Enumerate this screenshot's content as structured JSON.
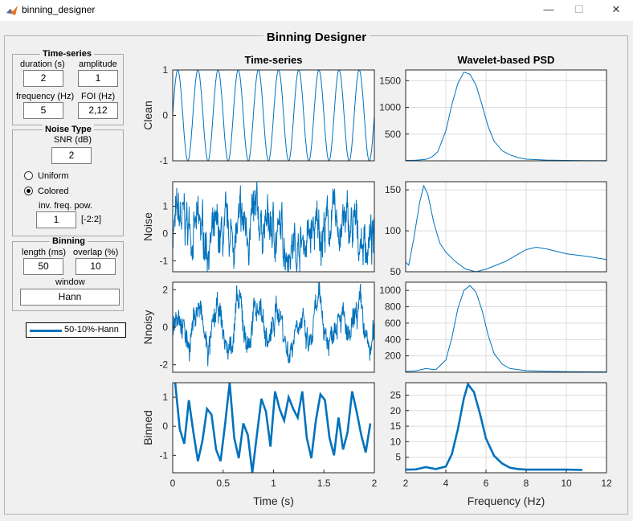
{
  "window": {
    "title": "binning_designer",
    "minimize_glyph": "—",
    "maximize_glyph": "☐",
    "close_glyph": "✕"
  },
  "panel_title": "Binning Designer",
  "timeseries_group": {
    "title": "Time-series",
    "duration_label": "duration (s)",
    "duration_value": "2",
    "amplitude_label": "amplitude",
    "amplitude_value": "1",
    "frequency_label": "frequency (Hz)",
    "frequency_value": "5",
    "foi_label": "FOI (Hz)",
    "foi_value": "2,12"
  },
  "noise_group": {
    "title": "Noise Type",
    "snr_label": "SNR (dB)",
    "snr_value": "2",
    "uniform_label": "Uniform",
    "colored_label": "Colored",
    "selected": "Colored",
    "inv_freq_label": "inv. freq. pow.",
    "inv_freq_value": "1",
    "inv_freq_range": "[-2:2]"
  },
  "binning_group": {
    "title": "Binning",
    "length_label": "length (ms)",
    "length_value": "50",
    "overlap_label": "overlap (%)",
    "overlap_value": "10",
    "window_label": "window",
    "window_value": "Hann"
  },
  "legend": {
    "label": "50-10%-Hann",
    "color": "#0072bd"
  },
  "colors": {
    "line": "#0072bd",
    "grid": "#dcdcdc"
  },
  "chart_data": [
    {
      "type": "line",
      "title": "Time-series",
      "ylabel": "Clean",
      "xlim": [
        0,
        2
      ],
      "ylim": [
        -1,
        1
      ],
      "yticks": [
        -1,
        0,
        1
      ],
      "series": [
        {
          "function": "sin",
          "frequency": 5,
          "amplitude": 1
        }
      ]
    },
    {
      "type": "line",
      "title": "Wavelet-based PSD",
      "xlim": [
        2,
        12
      ],
      "ylim": [
        0,
        1700
      ],
      "yticks": [
        500,
        1000,
        1500
      ],
      "series": [
        {
          "x": [
            2,
            2.5,
            3,
            3.3,
            3.6,
            4,
            4.3,
            4.6,
            4.9,
            5.2,
            5.5,
            5.8,
            6.1,
            6.4,
            6.8,
            7.2,
            7.6,
            8,
            9,
            10,
            10.5,
            11,
            12
          ],
          "y": [
            8,
            10,
            25,
            70,
            170,
            560,
            1050,
            1450,
            1660,
            1620,
            1420,
            1050,
            650,
            370,
            190,
            110,
            60,
            30,
            14,
            8,
            6,
            5,
            5
          ]
        }
      ]
    },
    {
      "type": "line",
      "ylabel": "Noise",
      "xlim": [
        0,
        2
      ],
      "ylim": [
        -1.4,
        1.9
      ],
      "yticks": [
        -1,
        0,
        1
      ],
      "series": [
        {
          "kind": "noise",
          "range": [
            -1.4,
            1.9
          ]
        }
      ]
    },
    {
      "type": "line",
      "xlim": [
        2,
        12
      ],
      "ylim": [
        50,
        160
      ],
      "yticks": [
        50,
        100,
        150
      ],
      "series": [
        {
          "x": [
            2,
            2.15,
            2.4,
            2.7,
            2.9,
            3.1,
            3.4,
            3.7,
            4,
            4.5,
            5,
            5.5,
            6,
            6.5,
            7,
            7.5,
            8,
            8.5,
            9,
            10,
            11,
            12
          ],
          "y": [
            62,
            58,
            90,
            135,
            155,
            145,
            110,
            85,
            74,
            62,
            53,
            50,
            53,
            58,
            63,
            70,
            77,
            80,
            78,
            72,
            69,
            65
          ]
        }
      ]
    },
    {
      "type": "line",
      "ylabel": "Nnoisy",
      "xlim": [
        0,
        2
      ],
      "ylim": [
        -2.4,
        2.4
      ],
      "yticks": [
        -2,
        0,
        2
      ],
      "series": [
        {
          "kind": "noisy",
          "range": [
            -2.4,
            2.4
          ]
        }
      ]
    },
    {
      "type": "line",
      "xlim": [
        2,
        12
      ],
      "ylim": [
        0,
        1100
      ],
      "yticks": [
        200,
        400,
        600,
        800,
        1000
      ],
      "series": [
        {
          "x": [
            2,
            2.5,
            3,
            3.5,
            4,
            4.3,
            4.6,
            4.9,
            5.2,
            5.5,
            5.8,
            6.1,
            6.4,
            6.8,
            7.2,
            8,
            9,
            10,
            11,
            12
          ],
          "y": [
            10,
            18,
            45,
            30,
            150,
            420,
            780,
            1000,
            1060,
            980,
            760,
            460,
            230,
            100,
            45,
            20,
            12,
            8,
            6,
            5
          ]
        }
      ]
    },
    {
      "type": "line",
      "ylabel": "Binned",
      "xlabel": "Time (s)",
      "xlim": [
        0,
        2
      ],
      "ylim": [
        -1.6,
        1.5
      ],
      "yticks": [
        -1,
        0,
        1
      ],
      "xticks": [
        0,
        0.5,
        1,
        1.5,
        2
      ],
      "series": [
        {
          "x": [
            0.025,
            0.07,
            0.115,
            0.16,
            0.205,
            0.25,
            0.295,
            0.34,
            0.385,
            0.43,
            0.475,
            0.52,
            0.565,
            0.61,
            0.655,
            0.7,
            0.745,
            0.79,
            0.835,
            0.88,
            0.925,
            0.97,
            1.015,
            1.06,
            1.105,
            1.15,
            1.195,
            1.24,
            1.285,
            1.33,
            1.375,
            1.42,
            1.465,
            1.51,
            1.555,
            1.6,
            1.645,
            1.69,
            1.735,
            1.78,
            1.825,
            1.87,
            1.915,
            1.96
          ],
          "y": [
            1.5,
            -0.1,
            -0.6,
            0.9,
            -0.2,
            -1.2,
            -0.5,
            0.6,
            0.4,
            -0.8,
            -1.2,
            0.1,
            1.5,
            -0.4,
            -1.1,
            0.1,
            -0.3,
            -1.6,
            -0.3,
            0.95,
            0.5,
            -0.7,
            1.2,
            0.6,
            0.2,
            1.0,
            0.6,
            0.3,
            1.2,
            -0.4,
            -1.1,
            0.2,
            1.1,
            0.9,
            -0.4,
            -1.0,
            0.3,
            -0.8,
            -0.2,
            1.2,
            0.5,
            -0.3,
            -0.9,
            0.1
          ]
        }
      ]
    },
    {
      "type": "line",
      "xlabel": "Frequency (Hz)",
      "xlim": [
        2,
        12
      ],
      "ylim": [
        0,
        29
      ],
      "yticks": [
        5,
        10,
        15,
        20,
        25
      ],
      "xticks": [
        2,
        4,
        6,
        8,
        10,
        12
      ],
      "series": [
        {
          "x": [
            2,
            2.5,
            3,
            3.5,
            4,
            4.3,
            4.6,
            4.9,
            5.1,
            5.4,
            5.7,
            6.0,
            6.4,
            6.8,
            7.2,
            7.6,
            8,
            9,
            10,
            10.8
          ],
          "y": [
            1,
            1.1,
            1.8,
            1.2,
            2.0,
            6,
            14,
            24,
            28.5,
            26,
            19,
            11,
            5.5,
            3,
            1.6,
            1.2,
            1,
            1,
            1,
            0.9
          ]
        }
      ]
    }
  ]
}
